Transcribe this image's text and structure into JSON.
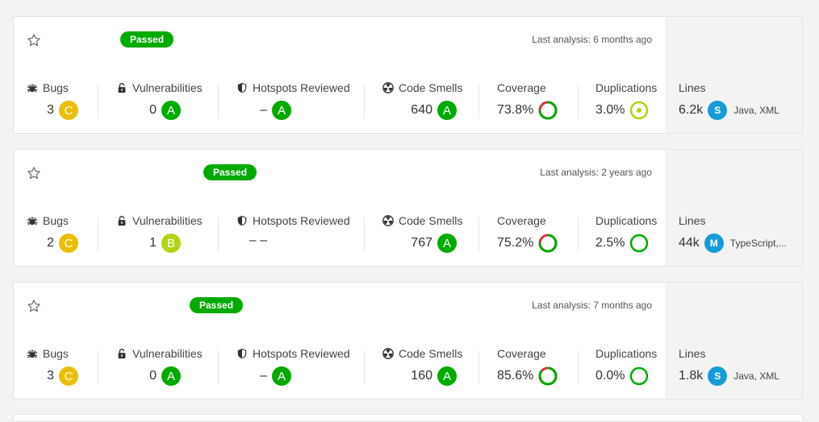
{
  "projects": [
    {
      "status": "Passed",
      "last_analysis": "Last analysis: 6 months ago",
      "bugs": {
        "label": "Bugs",
        "value": "3",
        "rating": "C"
      },
      "vulns": {
        "label": "Vulnerabilities",
        "value": "0",
        "rating": "A"
      },
      "hotspots": {
        "label": "Hotspots Reviewed",
        "value": "–",
        "rating": "A"
      },
      "smells": {
        "label": "Code Smells",
        "value": "640",
        "rating": "A"
      },
      "coverage": {
        "label": "Coverage",
        "value": "73.8%",
        "percent": 73.8
      },
      "dup": {
        "label": "Duplications",
        "value": "3.0%",
        "percent": 3.0
      },
      "lines": {
        "label": "Lines",
        "value": "6.2k",
        "size": "S",
        "langs": "Java, XML"
      }
    },
    {
      "status": "Passed",
      "last_analysis": "Last analysis: 2 years ago",
      "bugs": {
        "label": "Bugs",
        "value": "2",
        "rating": "C"
      },
      "vulns": {
        "label": "Vulnerabilities",
        "value": "1",
        "rating": "B"
      },
      "hotspots": {
        "label": "Hotspots Reviewed",
        "value": "– –",
        "rating": ""
      },
      "smells": {
        "label": "Code Smells",
        "value": "767",
        "rating": "A"
      },
      "coverage": {
        "label": "Coverage",
        "value": "75.2%",
        "percent": 75.2
      },
      "dup": {
        "label": "Duplications",
        "value": "2.5%",
        "percent": 2.5
      },
      "lines": {
        "label": "Lines",
        "value": "44k",
        "size": "M",
        "langs": "TypeScript,..."
      }
    },
    {
      "status": "Passed",
      "last_analysis": "Last analysis: 7 months ago",
      "bugs": {
        "label": "Bugs",
        "value": "3",
        "rating": "C"
      },
      "vulns": {
        "label": "Vulnerabilities",
        "value": "0",
        "rating": "A"
      },
      "hotspots": {
        "label": "Hotspots Reviewed",
        "value": "–",
        "rating": "A"
      },
      "smells": {
        "label": "Code Smells",
        "value": "160",
        "rating": "A"
      },
      "coverage": {
        "label": "Coverage",
        "value": "85.6%",
        "percent": 85.6
      },
      "dup": {
        "label": "Duplications",
        "value": "0.0%",
        "percent": 0.0
      },
      "lines": {
        "label": "Lines",
        "value": "1.8k",
        "size": "S",
        "langs": "Java, XML"
      }
    }
  ],
  "colors": {
    "passed": "#00aa00",
    "A": "#00aa00",
    "B": "#b0d513",
    "C": "#eabe06",
    "coverage_fail": "#d4333f",
    "lang": "#179bd6"
  },
  "icons": {
    "bugs": "bug-icon",
    "vulns": "lock-icon",
    "hotspots": "shield-icon",
    "smells": "radiation-icon",
    "star": "star-icon"
  }
}
